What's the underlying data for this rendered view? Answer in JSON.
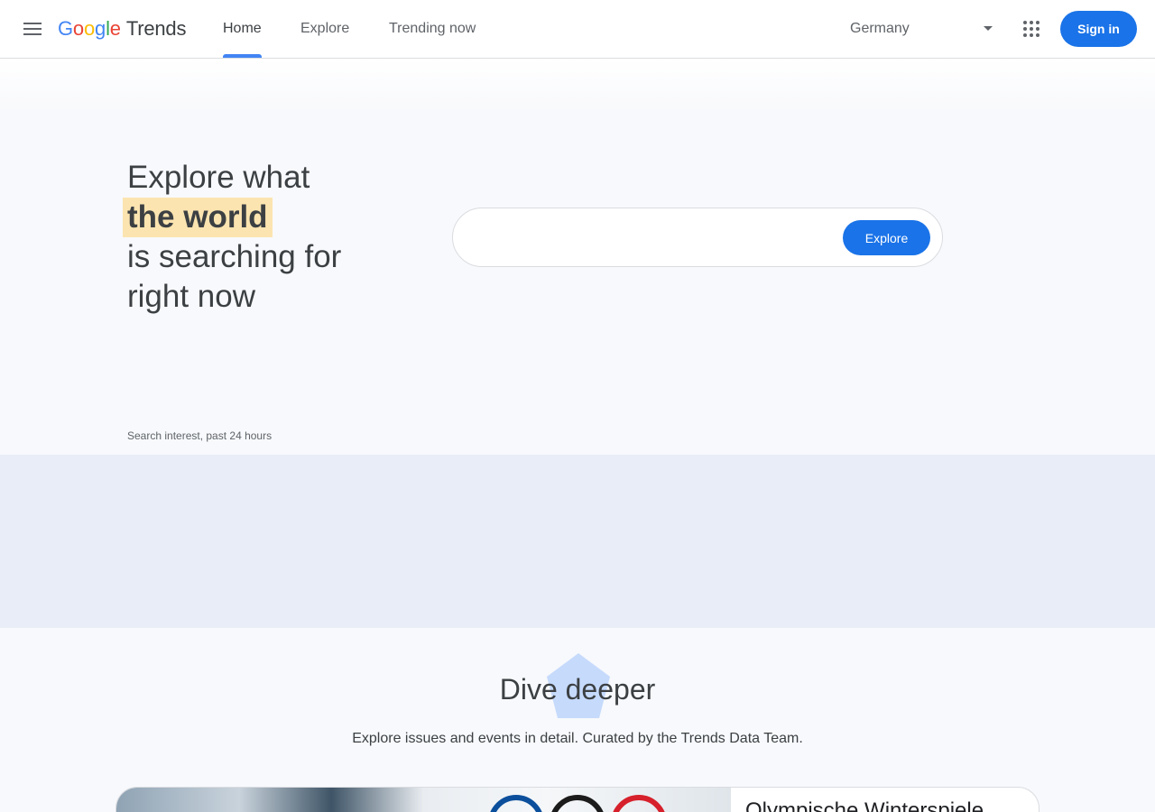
{
  "header": {
    "logo_word": "Google",
    "logo_product": "Trends",
    "tabs": [
      {
        "label": "Home",
        "active": true
      },
      {
        "label": "Explore",
        "active": false
      },
      {
        "label": "Trending now",
        "active": false
      }
    ],
    "country": "Germany",
    "signin_label": "Sign in"
  },
  "hero": {
    "headline_line1": "Explore what",
    "headline_highlight": "the world",
    "headline_line3": "is searching for",
    "headline_line4": "right now",
    "search_value": "",
    "explore_label": "Explore",
    "caption": "Search interest, past 24 hours"
  },
  "dive": {
    "title": "Dive deeper",
    "subtitle": "Explore issues and events in detail. Curated by the Trends Data Team.",
    "story_title": "Olympische Winterspiele"
  },
  "colors": {
    "accent": "#1a73e8",
    "tab_indicator": "#4285f4",
    "highlight": "#fbe4b0",
    "band": "#e8edf7"
  }
}
